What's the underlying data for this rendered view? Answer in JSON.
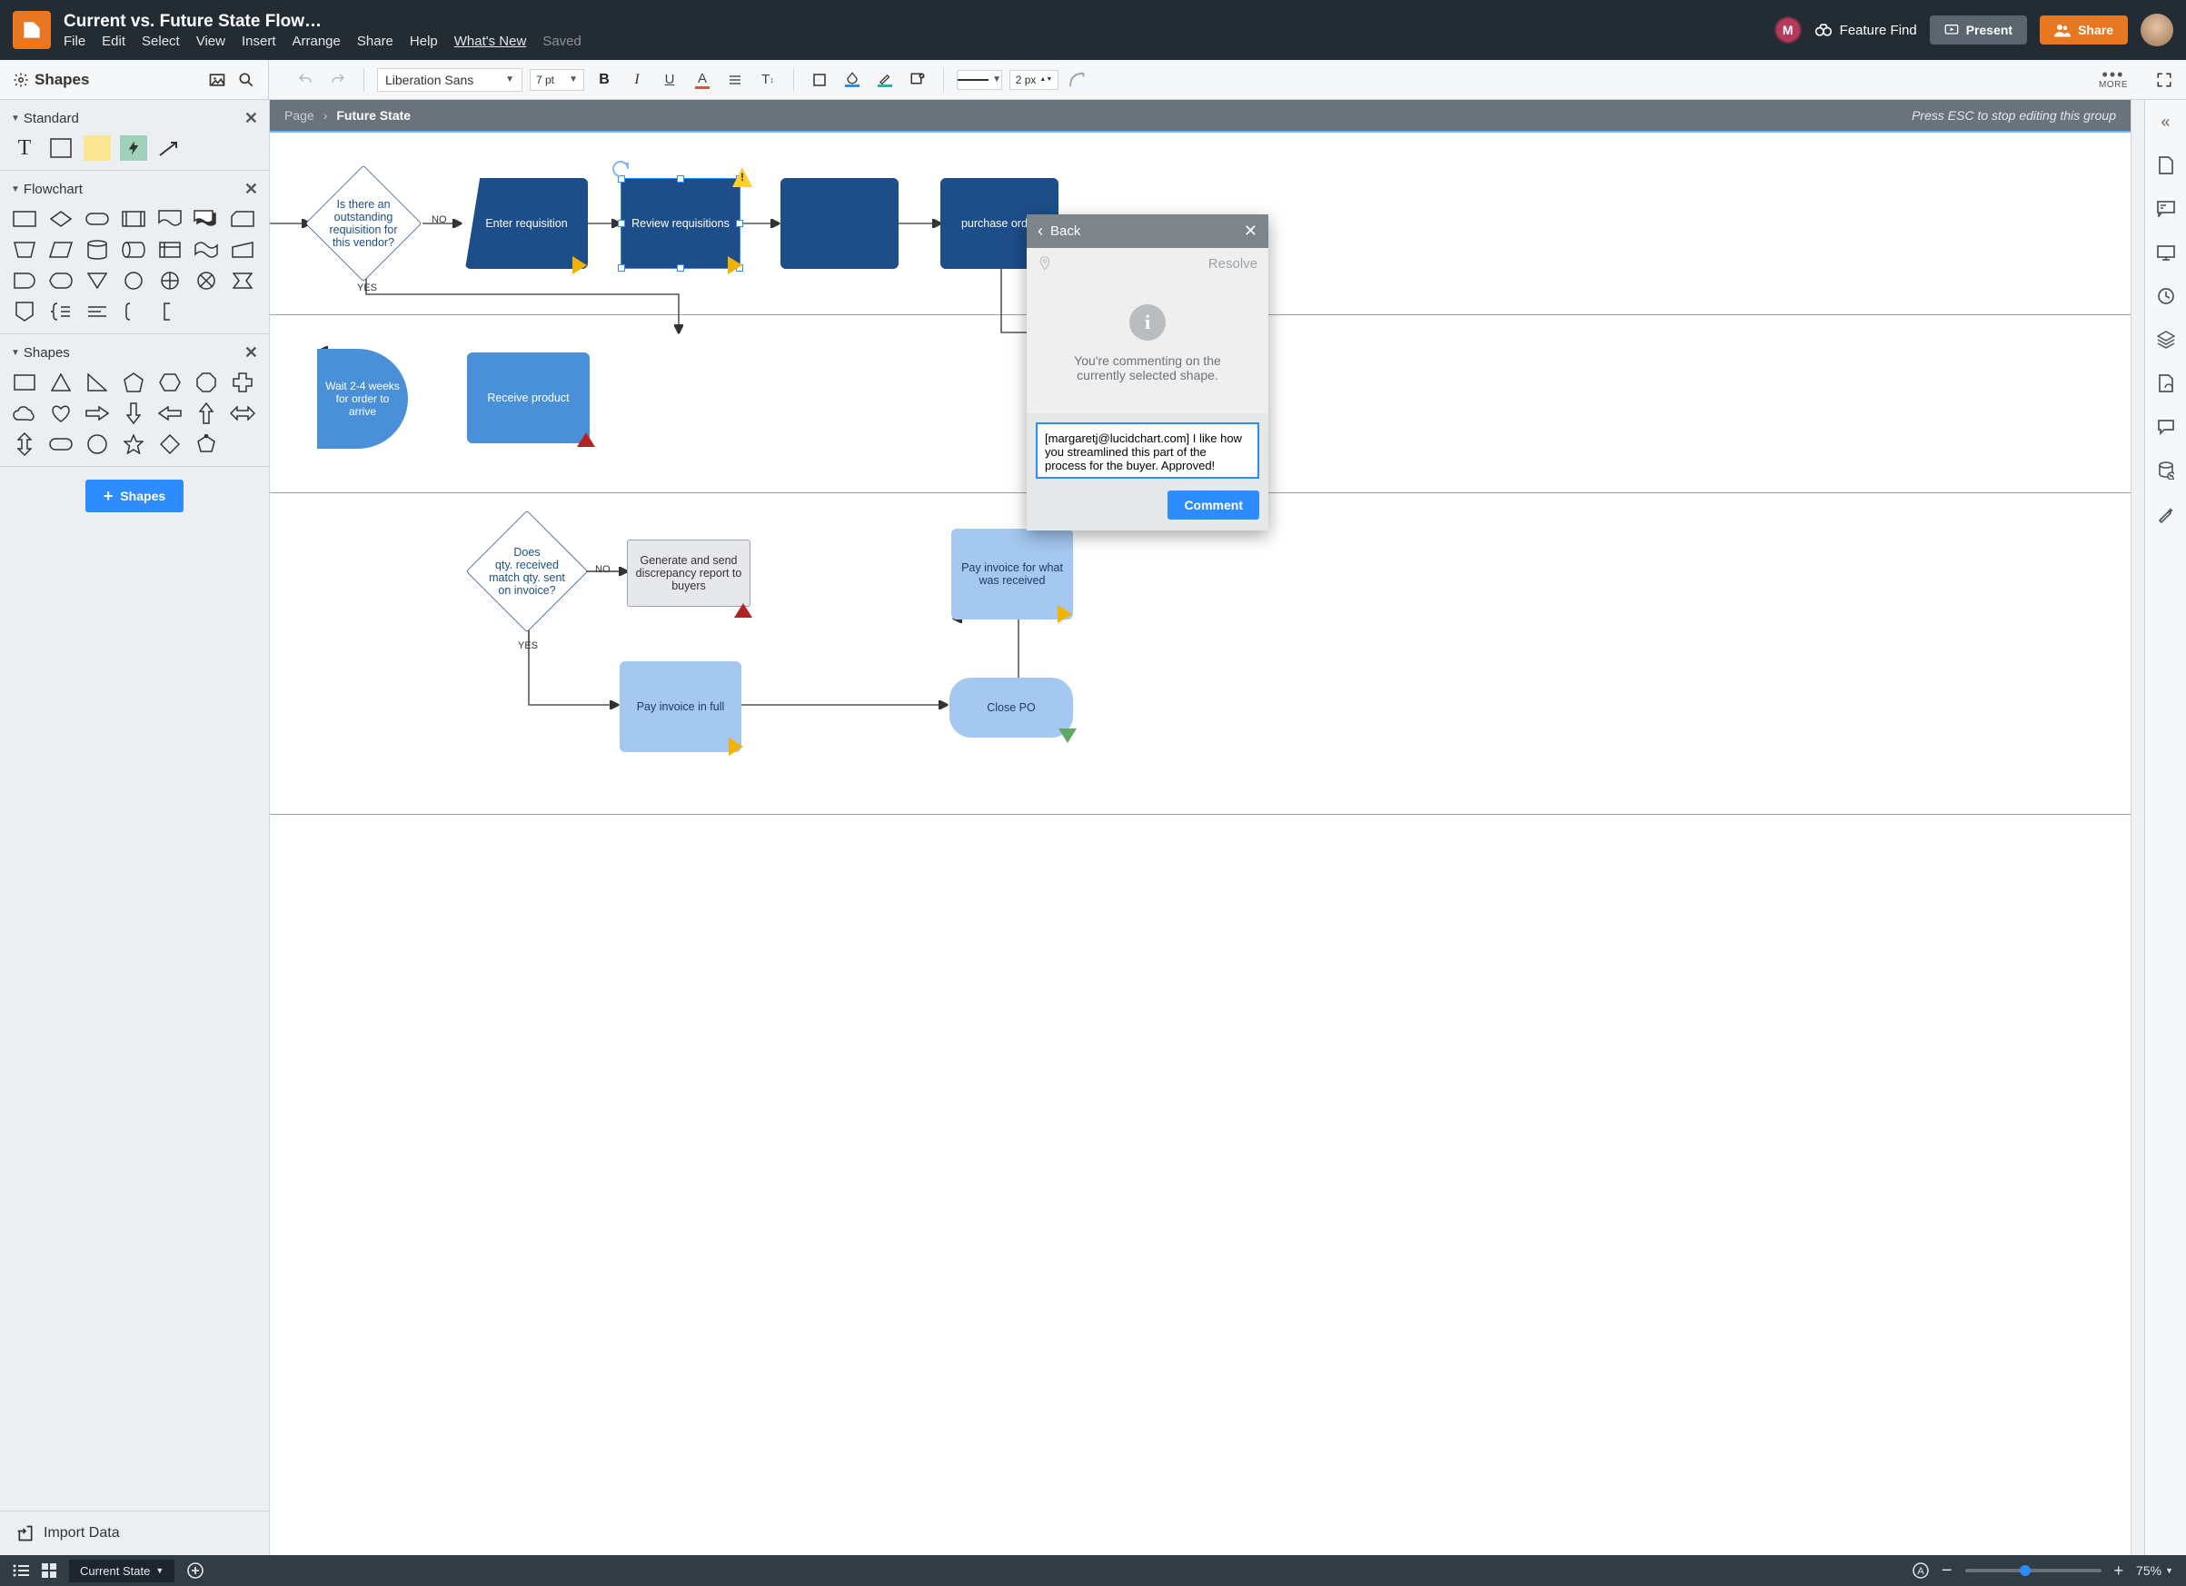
{
  "header": {
    "title": "Current vs. Future State Flow…",
    "menu": {
      "file": "File",
      "edit": "Edit",
      "select": "Select",
      "view": "View",
      "insert": "Insert",
      "arrange": "Arrange",
      "share": "Share",
      "help": "Help",
      "whats_new": "What's New",
      "saved": "Saved"
    },
    "avatar_initial": "M",
    "feature_find": "Feature Find",
    "present": "Present",
    "share_btn": "Share"
  },
  "toolbar": {
    "font": "Liberation Sans",
    "font_size": "7 pt",
    "line_width": "2 px",
    "more_label": "MORE"
  },
  "shapes_panel": {
    "title": "Shapes",
    "sec_standard": "Standard",
    "sec_flowchart": "Flowchart",
    "sec_shapes": "Shapes",
    "shapes_btn": "Shapes",
    "import_data": "Import Data"
  },
  "breadcrumb": {
    "page_label": "Page",
    "current": "Future State",
    "hint": "Press ESC to stop editing this group"
  },
  "canvas": {
    "decision_outstanding": "Is there an outstanding requisition for this vendor?",
    "enter_req": "Enter requisition",
    "review_req": "Review requisitions",
    "submit_po": "purchase order",
    "wait_2_4": "Wait 2-4 weeks for order to arrive",
    "receive_product": "Receive product",
    "decision_qty": "Does\nqty. received match qty. sent on invoice?",
    "discrepency": "Generate and send discrepancy report to buyers",
    "pay_received": "Pay invoice for what was received",
    "pay_full": "Pay invoice in full",
    "close_po": "Close PO",
    "label_no": "NO",
    "label_yes": "YES",
    "label_no2": "NO",
    "label_yes2": "YES"
  },
  "comment": {
    "back": "Back",
    "resolve": "Resolve",
    "body_line1": "You're commenting on the",
    "body_line2": "currently selected shape.",
    "input_value": "[margaretj@lucidchart.com] I like how you streamlined this part of the process for the buyer. Approved!",
    "button": "Comment"
  },
  "footer": {
    "state_select": "Current State",
    "zoom_pct": "75%"
  }
}
